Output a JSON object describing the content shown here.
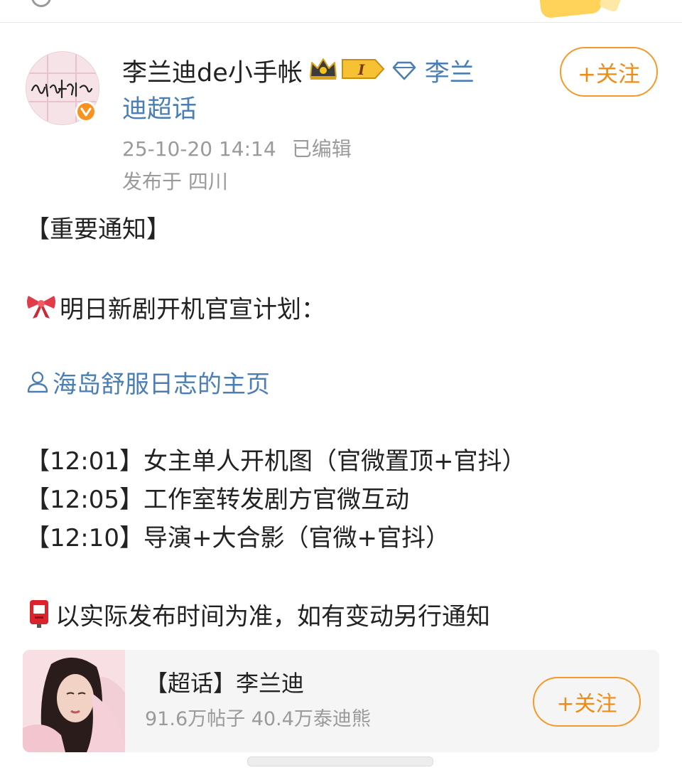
{
  "post": {
    "author_name": "李兰迪de小手帐",
    "topic_line1": "李兰",
    "topic_line2": "迪超话",
    "level_badge": "I",
    "timestamp": "25-10-20 14:14",
    "edited": "已编辑",
    "location": "发布于 四川",
    "follow_label": "+关注",
    "content": {
      "heading": "【重要通知】",
      "line_intro": "明日新剧开机官宣计划：",
      "mention": "海岛舒服日志的主页",
      "schedule": [
        "【12:01】女主单人开机图（官微置顶+官抖）",
        "【12:05】工作室转发剧方官微互动",
        "【12:10】导演+大合影（官微+官抖）"
      ],
      "note": "以实际发布时间为准，如有变动另行通知"
    }
  },
  "supertopic_card": {
    "title": "【超话】李兰迪",
    "stats": "91.6万帖子 40.4万泰迪熊",
    "follow_label": "+关注"
  },
  "icons": {
    "avatar": "handwritten-logo-avatar",
    "verified": "verified-v-icon",
    "crown": "crown-icon",
    "level": "level-badge-icon",
    "diamond": "diamond-icon",
    "bow": "ribbon-bow-icon",
    "user": "user-icon",
    "mailbox": "postbox-icon"
  },
  "colors": {
    "link": "#4b7fb3",
    "accent": "#f08b16",
    "muted": "#9a9a9a",
    "card_bg": "#f5f5f5"
  }
}
